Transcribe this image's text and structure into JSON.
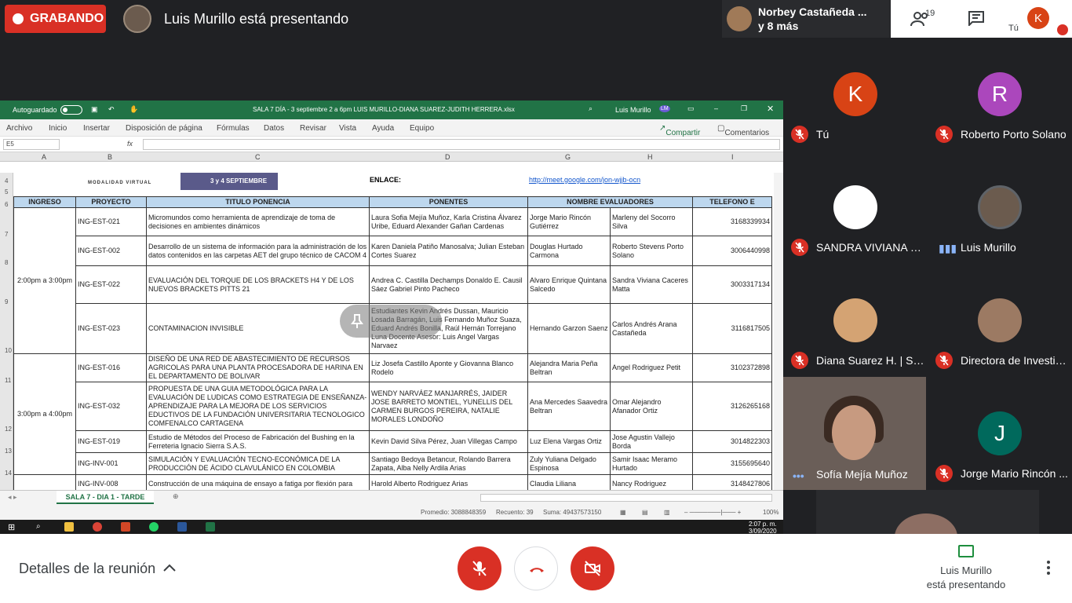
{
  "meet": {
    "recording_label": "GRABANDO",
    "presenter_banner": "Luis Murillo está presentando",
    "others_name": "Norbey Castañeda ...",
    "others_more": "y 8 más",
    "participant_count": "19",
    "you_label": "Tú",
    "you_initial": "K",
    "details_label": "Detalles de la reunión",
    "presenting_name": "Luis Murillo",
    "presenting_label": "está presentando",
    "accent_red": "#d93025",
    "accent_blue": "#1a73e8"
  },
  "tiles": [
    {
      "name": "Tú",
      "initial": "K",
      "color": "#d84315",
      "muted": true
    },
    {
      "name": "Roberto Porto Solano",
      "initial": "R",
      "color": "#ab47bc",
      "muted": true
    },
    {
      "name": "SANDRA VIVIANA C...",
      "initial": "",
      "color": "#ffffff",
      "muted": true
    },
    {
      "name": "Luis Murillo",
      "initial": "",
      "color": "#6b5b4e",
      "muted": false
    },
    {
      "name": "Diana Suarez H. | Se...",
      "initial": "",
      "color": "#d4a373",
      "muted": true
    },
    {
      "name": "Directora de Investig...",
      "initial": "",
      "color": "#9c7a63",
      "muted": true
    },
    {
      "name": "Sofía Mejía Muñoz",
      "initial": "",
      "color": "#6a5e58",
      "muted": false
    },
    {
      "name": "Jorge Mario Rincón ...",
      "initial": "J",
      "color": "#00695c",
      "muted": true
    }
  ],
  "excel": {
    "autosave": "Autoguardado",
    "file_title": "SALA 7 DÍA - 3 septiembre 2 a 6pm LUIS MURILLO-DIANA SUAREZ-JUDITH HERRERA.xlsx",
    "user": "Luis Murillo",
    "user_initials": "LM",
    "menu": [
      "Archivo",
      "Inicio",
      "Insertar",
      "Disposición de página",
      "Fórmulas",
      "Datos",
      "Revisar",
      "Vista",
      "Ayuda",
      "Equipo"
    ],
    "share": "Compartir",
    "comments": "Comentarios",
    "cell_ref": "E5",
    "fx": "fx",
    "columns": [
      "A",
      "B",
      "C",
      "D",
      "G",
      "H",
      "I"
    ],
    "logo_text": "MODALIDAD VIRTUAL",
    "banner_text": "3 y 4 SEPTIEMBRE",
    "enlace": "ENLACE:",
    "link": "http://meet.google.com/jon-wjjb-ocn",
    "headers": [
      "INGRESO",
      "PROYECTO",
      "TITULO PONENCIA",
      "PONENTES",
      "NOMBRE EVALUADORES",
      "TELEFONO E"
    ],
    "slot1": "2:00pm a 3:00pm",
    "slot2": "3:00pm a 4:00pm",
    "rows": [
      {
        "proyecto": "ING-EST-021",
        "titulo": "Micromundos como herramienta de aprendizaje de toma de decisiones en ambientes dinámicos",
        "ponentes": "Laura Sofia Mejía Muñoz, Karla Cristina Álvarez Uribe, Eduard Alexander Gañan Cardenas",
        "eval1": "Jorge Mario Rincón Gutiérrez",
        "eval2": "Marleny del Socorro Silva",
        "tel": "3168339934"
      },
      {
        "proyecto": "ING-EST-002",
        "titulo": "Desarrollo de un sistema de información para la administración de los datos contenidos en las carpetas AET del grupo técnico de CACOM 4",
        "ponentes": "Karen Daniela Patiño Manosalva; Julian Esteban Cortes Suarez",
        "eval1": "Douglas Hurtado Carmona",
        "eval2": "Roberto Stevens Porto Solano",
        "tel": "3006440998"
      },
      {
        "proyecto": "ING-EST-022",
        "titulo": "EVALUACIÓN DEL TORQUE DE LOS BRACKETS H4 Y DE LOS NUEVOS BRACKETS PITTS 21",
        "ponentes": "Andrea C. Castilla Dechamps Donaldo E. Causil Sáez Gabriel Pinto Pacheco",
        "eval1": "Alvaro Enrique Quintana Salcedo",
        "eval2": "Sandra Viviana Caceres Matta",
        "tel": "3003317134"
      },
      {
        "proyecto": "ING-EST-023",
        "titulo": "CONTAMINACION INVISIBLE",
        "ponentes": "Estudiantes Kevin Andrés Dussan, Mauricio Losada Barragán, Luis Fernando Muñoz Suaza, Eduard Andrés Bonilla, Raúl Hernán Torrejano Luna Docente Asesor: Luis Angel Vargas Narvaez",
        "eval1": "Hernando Garzon Saenz",
        "eval2": "Carlos Andrés Arana Castañeda",
        "tel": "3116817505"
      },
      {
        "proyecto": "ING-EST-016",
        "titulo": "DISEÑO DE UNA RED DE ABASTECIMIENTO DE RECURSOS AGRICOLAS PARA UNA PLANTA PROCESADORA DE HARINA EN EL DEPARTAMENTO DE BOLIVAR",
        "ponentes": "Liz Josefa Castillo Aponte y Giovanna Blanco Rodelo",
        "eval1": "Alejandra Maria Peña Beltran",
        "eval2": "Angel Rodriguez Petit",
        "tel": "3102372898"
      },
      {
        "proyecto": "ING-EST-032",
        "titulo": "PROPUESTA DE UNA GUIA METODOLÓGICA PARA LA EVALUACIÓN DE LUDICAS COMO ESTRATEGIA DE ENSEÑANZA-APRENDIZAJE PARA LA MEJORA DE LOS SERVICIOS EDUCTIVOS DE LA FUNDACIÓN UNIVERSITARIA TECNOLOGICO COMFENALCO CARTAGENA",
        "ponentes": "WENDY NARVÁEZ MANJARRÉS, JAIDER JOSE BARRETO MONTIEL, YUNELLIS DEL CARMEN BURGOS PEREIRA, NATALIE MORALES LONDOÑO",
        "eval1": "Ana Mercedes Saavedra Beltran",
        "eval2": "Omar Alejandro Afanador Ortiz",
        "tel": "3126265168"
      },
      {
        "proyecto": "ING-EST-019",
        "titulo": "Estudio de Métodos del Proceso de Fabricación del Bushing en la Ferreteria Ignacio Sierra S.A.S.",
        "ponentes": "Kevin David Silva Pérez, Juan Villegas Campo",
        "eval1": "Luz Elena Vargas Ortiz",
        "eval2": "Jose Agustin Vallejo Borda",
        "tel": "3014822303"
      },
      {
        "proyecto": "ING-INV-001",
        "titulo": "SIMULACIÓN Y EVALUACIÓN TECNO-ECONÓMICA DE LA PRODUCCIÓN DE ÁCIDO CLAVULÁNICO EN COLOMBIA",
        "ponentes": "Santiago Bedoya Betancur, Rolando Barrera Zapata, Alba Nelly Ardila Arias",
        "eval1": "Zuly Yuliana Delgado Espinosa",
        "eval2": "Samir Isaac Meramo Hurtado",
        "tel": "3155695640"
      },
      {
        "proyecto": "ING-INV-008",
        "titulo": "Construcción de una máquina de ensayo a fatiga por flexión para",
        "ponentes": "Harold Alberto Rodriguez Arias",
        "eval1": "Claudia Liliana",
        "eval2": "Nancy Rodriguez",
        "tel": "3148427806"
      }
    ],
    "sheet_tab": "SALA 7 - DIA 1 - TARDE",
    "status_prom": "Promedio: 3088848359",
    "status_count": "Recuento: 39",
    "status_sum": "Suma: 49437573150",
    "zoom": "100%",
    "clock_time": "2:07 p. m.",
    "clock_date": "3/09/2020"
  }
}
